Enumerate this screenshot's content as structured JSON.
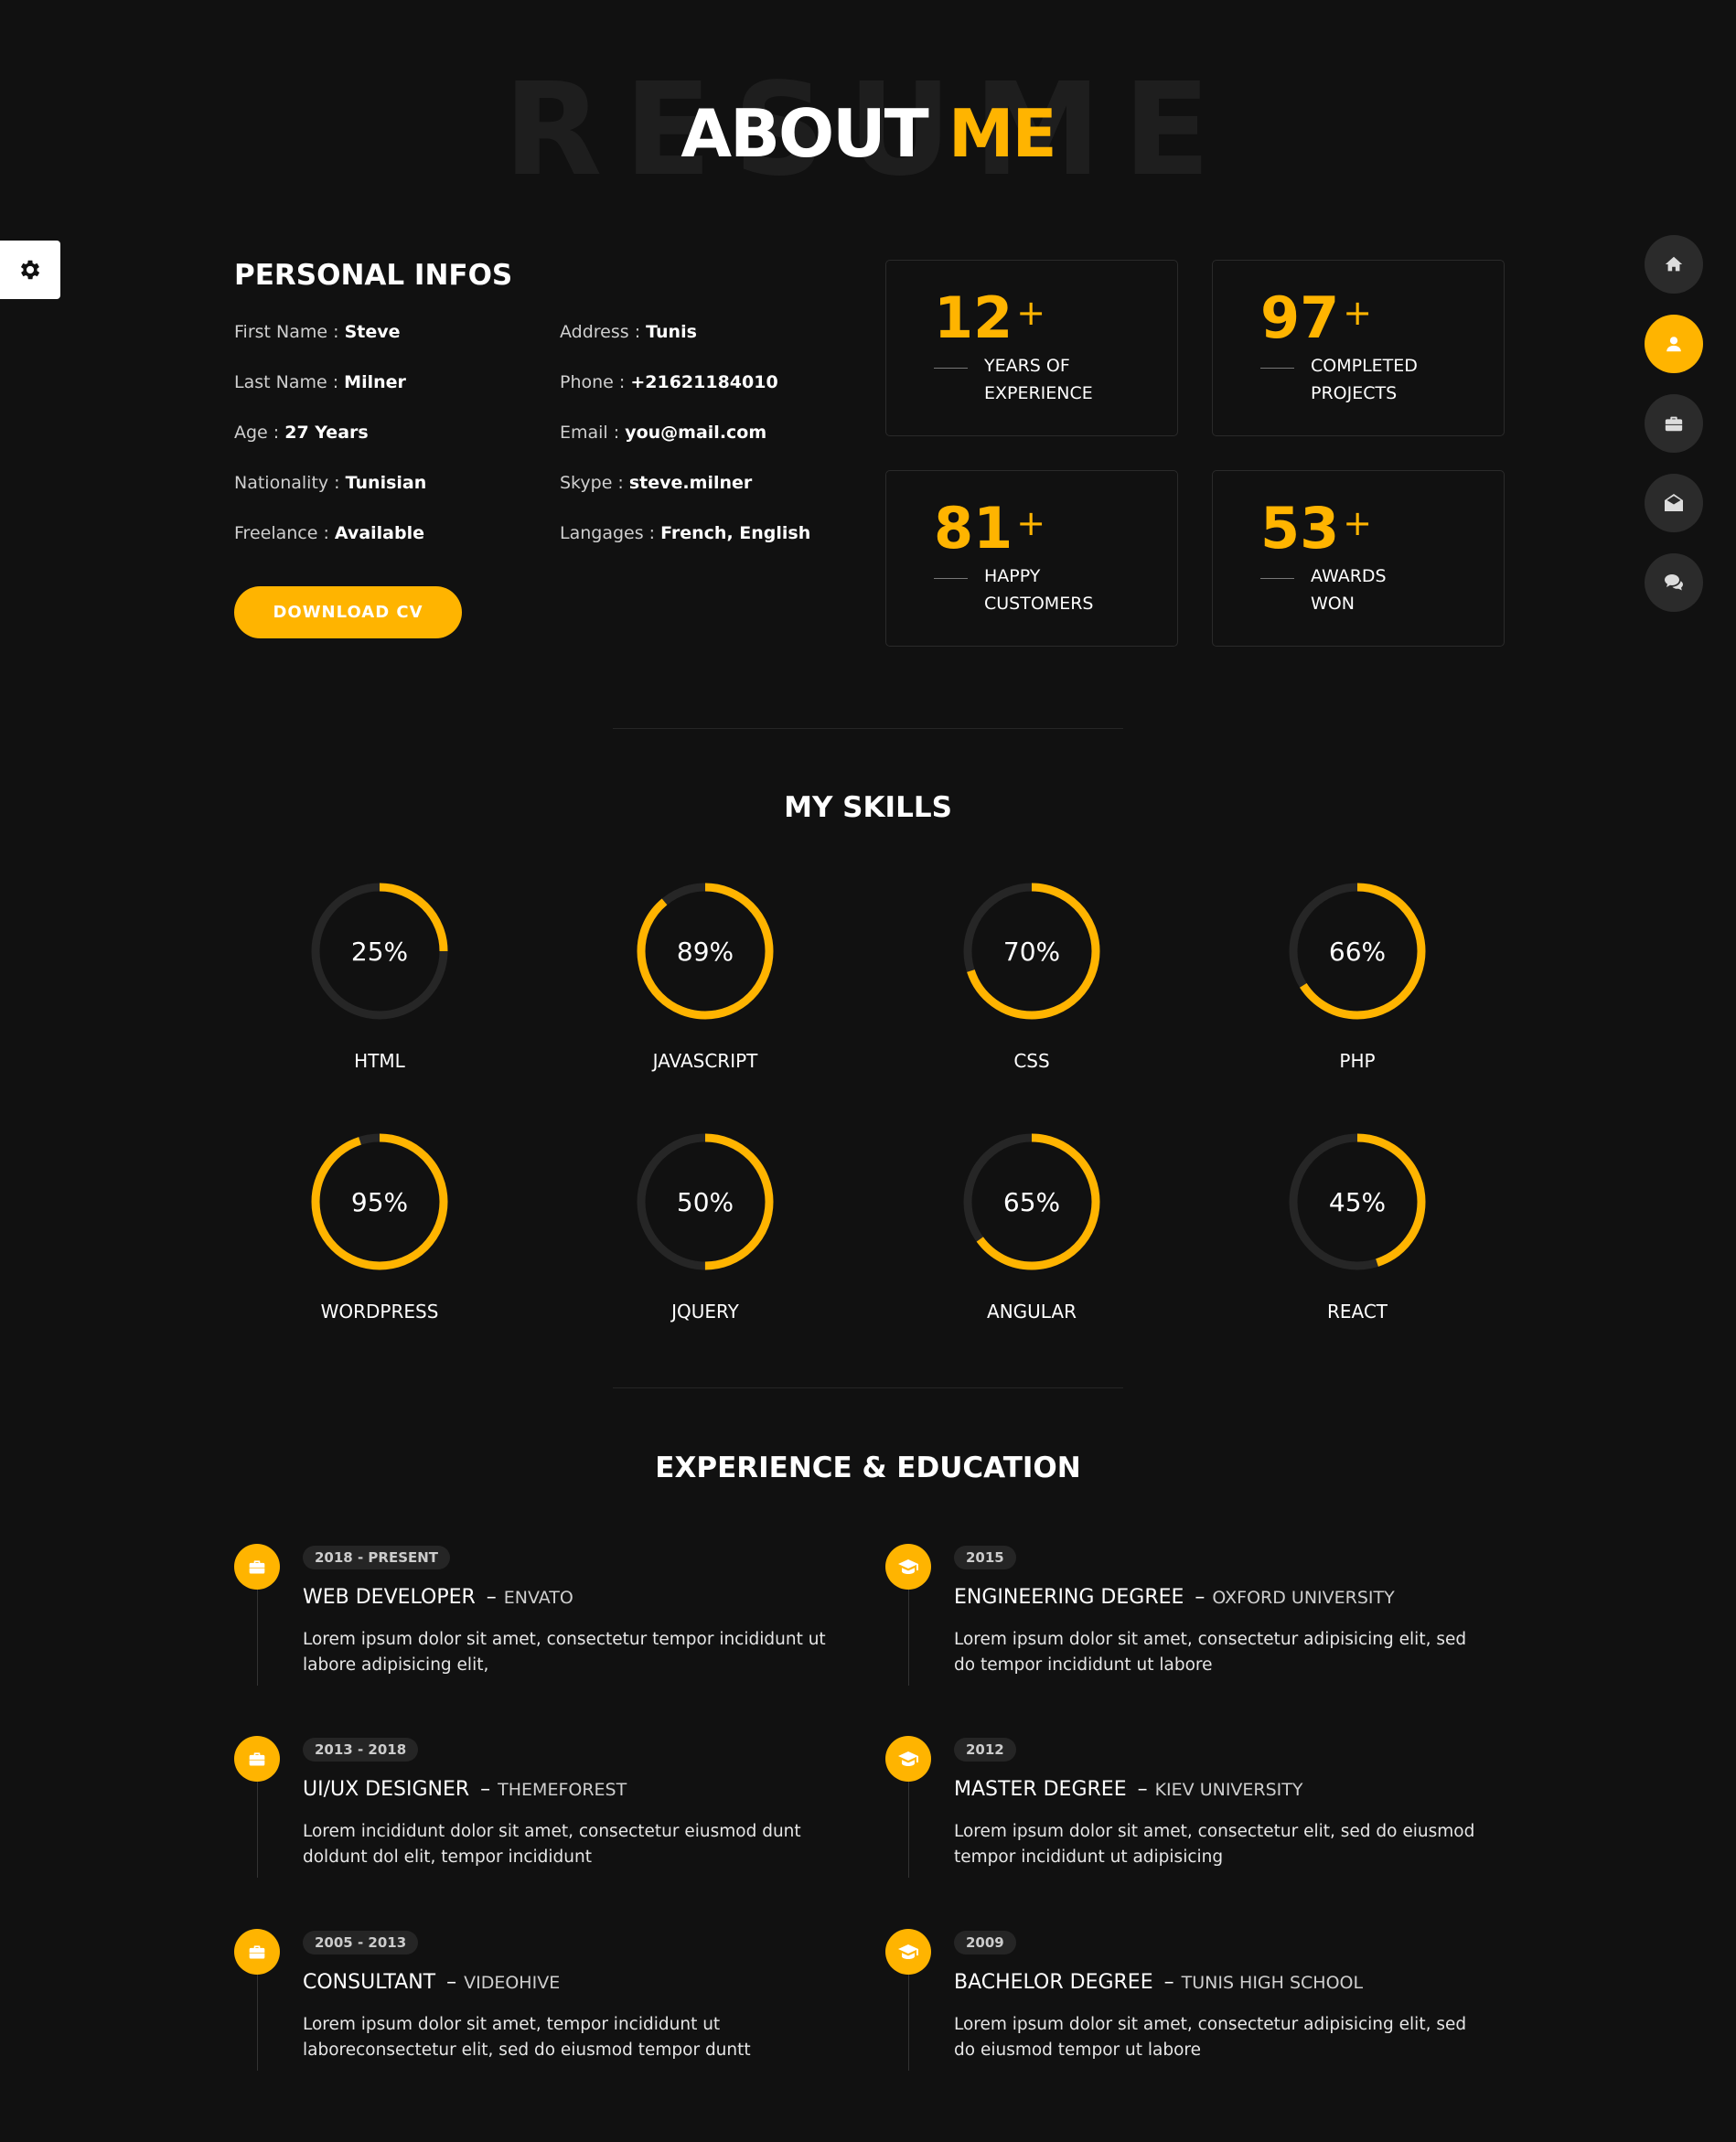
{
  "title": {
    "background": "RESUME",
    "main": "ABOUT",
    "accent": "ME"
  },
  "colors": {
    "background": "#111111",
    "accent": "#ffb400",
    "card_border": "#2a2a2a",
    "nav_inactive": "#2b2b2b"
  },
  "settings": {
    "icon": "gear-icon"
  },
  "side_nav": [
    {
      "icon": "home-icon",
      "active": false
    },
    {
      "icon": "user-icon",
      "active": true
    },
    {
      "icon": "briefcase-icon",
      "active": false
    },
    {
      "icon": "envelope-open-icon",
      "active": false
    },
    {
      "icon": "comments-icon",
      "active": false
    }
  ],
  "personal": {
    "title": "PERSONAL INFOS",
    "left": [
      {
        "label": "First Name : ",
        "value": "Steve"
      },
      {
        "label": "Last Name : ",
        "value": "Milner"
      },
      {
        "label": "Age : ",
        "value": "27 Years"
      },
      {
        "label": "Nationality : ",
        "value": "Tunisian"
      },
      {
        "label": "Freelance : ",
        "value": "Available"
      }
    ],
    "right": [
      {
        "label": "Address : ",
        "value": "Tunis"
      },
      {
        "label": "Phone : ",
        "value": "+21621184010"
      },
      {
        "label": "Email : ",
        "value": "you@mail.com"
      },
      {
        "label": "Skype : ",
        "value": "steve.milner"
      },
      {
        "label": "Langages : ",
        "value": "French, English"
      }
    ],
    "download_label": "DOWNLOAD CV"
  },
  "stats": [
    {
      "number": "12",
      "plus": "+",
      "line1": "YEARS OF",
      "line2": "EXPERIENCE"
    },
    {
      "number": "97",
      "plus": "+",
      "line1": "COMPLETED",
      "line2": "PROJECTS"
    },
    {
      "number": "81",
      "plus": "+",
      "line1": "HAPPY",
      "line2": "CUSTOMERS"
    },
    {
      "number": "53",
      "plus": "+",
      "line1": "AWARDS",
      "line2": "WON"
    }
  ],
  "skills": {
    "title": "MY SKILLS",
    "items": [
      {
        "name": "HTML",
        "percent": 25,
        "label": "25%"
      },
      {
        "name": "JAVASCRIPT",
        "percent": 89,
        "label": "89%"
      },
      {
        "name": "CSS",
        "percent": 70,
        "label": "70%"
      },
      {
        "name": "PHP",
        "percent": 66,
        "label": "66%"
      },
      {
        "name": "WORDPRESS",
        "percent": 95,
        "label": "95%"
      },
      {
        "name": "JQUERY",
        "percent": 50,
        "label": "50%"
      },
      {
        "name": "ANGULAR",
        "percent": 65,
        "label": "65%"
      },
      {
        "name": "REACT",
        "percent": 45,
        "label": "45%"
      }
    ]
  },
  "experience": {
    "title": "EXPERIENCE & EDUCATION",
    "items": [
      {
        "icon": "briefcase-icon",
        "date": "2018 - PRESENT",
        "role": "WEB DEVELOPER",
        "org": "ENVATO",
        "desc": "Lorem ipsum dolor sit amet, consectetur tempor incididunt ut labore adipisicing elit,"
      },
      {
        "icon": "graduation-cap-icon",
        "date": "2015",
        "role": "ENGINEERING DEGREE",
        "org": "OXFORD UNIVERSITY",
        "desc": "Lorem ipsum dolor sit amet, consectetur adipisicing elit, sed do tempor incididunt ut labore"
      },
      {
        "icon": "briefcase-icon",
        "date": "2013 - 2018",
        "role": "UI/UX DESIGNER",
        "org": "THEMEFOREST",
        "desc": "Lorem incididunt dolor sit amet, consectetur eiusmod dunt doldunt dol elit, tempor incididunt"
      },
      {
        "icon": "graduation-cap-icon",
        "date": "2012",
        "role": "MASTER DEGREE",
        "org": "KIEV UNIVERSITY",
        "desc": "Lorem ipsum dolor sit amet, consectetur elit, sed do eiusmod tempor incididunt ut adipisicing"
      },
      {
        "icon": "briefcase-icon",
        "date": "2005 - 2013",
        "role": "CONSULTANT",
        "org": "VIDEOHIVE",
        "desc": "Lorem ipsum dolor sit amet, tempor incididunt ut laboreconsectetur elit, sed do eiusmod tempor duntt"
      },
      {
        "icon": "graduation-cap-icon",
        "date": "2009",
        "role": "BACHELOR DEGREE",
        "org": "TUNIS HIGH SCHOOL",
        "desc": "Lorem ipsum dolor sit amet, consectetur adipisicing elit, sed do eiusmod tempor ut labore"
      }
    ]
  }
}
